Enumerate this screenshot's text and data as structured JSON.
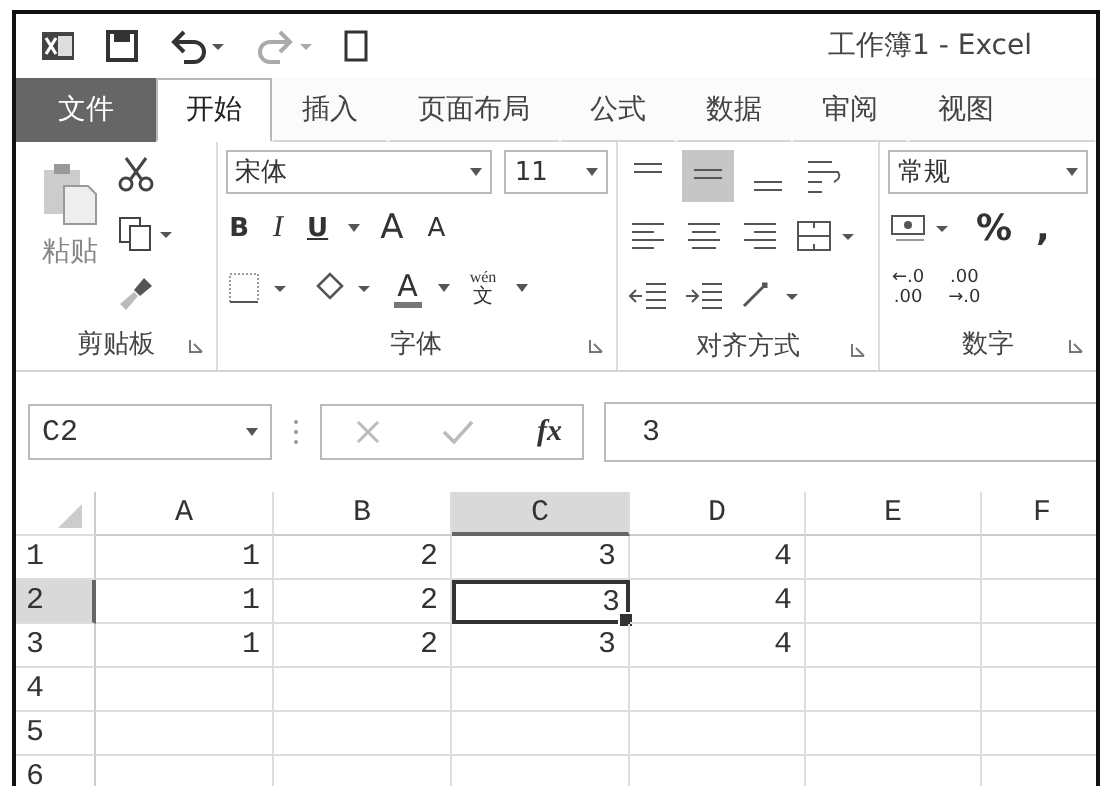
{
  "title_bar": {
    "title": "工作簿1 - Excel"
  },
  "tabs": [
    {
      "label": "文件",
      "kind": "file",
      "selected": false
    },
    {
      "label": "开始",
      "kind": "tab",
      "selected": true
    },
    {
      "label": "插入",
      "kind": "tab",
      "selected": false
    },
    {
      "label": "页面布局",
      "kind": "tab",
      "selected": false
    },
    {
      "label": "公式",
      "kind": "tab",
      "selected": false
    },
    {
      "label": "数据",
      "kind": "tab",
      "selected": false
    },
    {
      "label": "审阅",
      "kind": "tab",
      "selected": false
    },
    {
      "label": "视图",
      "kind": "tab",
      "selected": false
    }
  ],
  "ribbon": {
    "paste_label": "粘贴",
    "font_name": "宋体",
    "font_size": "11",
    "bold": "B",
    "italic": "I",
    "underline": "U",
    "grow_font": "A",
    "shrink_font": "A",
    "font_color": "A",
    "phonetic_top": "wén",
    "phonetic_bottom": "文",
    "number_format": "常规",
    "percent": "%",
    "comma": ",",
    "decimal_buttons": [
      {
        "top": "←.0",
        "bottom": ".00"
      },
      {
        "top": ".00",
        "bottom": "→.0"
      }
    ],
    "groups": [
      {
        "label": "剪贴板"
      },
      {
        "label": "字体"
      },
      {
        "label": "对齐方式"
      },
      {
        "label": "数字"
      }
    ]
  },
  "formula_bar": {
    "name_box": "C2",
    "fx": "fx",
    "formula": "3"
  },
  "sheet": {
    "columns": [
      {
        "label": "A",
        "selected": false
      },
      {
        "label": "B",
        "selected": false
      },
      {
        "label": "C",
        "selected": true
      },
      {
        "label": "D",
        "selected": false
      },
      {
        "label": "E",
        "selected": false
      },
      {
        "label": "F",
        "selected": false
      }
    ],
    "rows": [
      {
        "label": "1",
        "selected": false,
        "cells": [
          {
            "value": "1",
            "selected": false
          },
          {
            "value": "2",
            "selected": false
          },
          {
            "value": "3",
            "selected": false
          },
          {
            "value": "4",
            "selected": false
          }
        ]
      },
      {
        "label": "2",
        "selected": true,
        "cells": [
          {
            "value": "1",
            "selected": false
          },
          {
            "value": "2",
            "selected": false
          },
          {
            "value": "3",
            "selected": true
          },
          {
            "value": "4",
            "selected": false
          }
        ]
      },
      {
        "label": "3",
        "selected": false,
        "cells": [
          {
            "value": "1",
            "selected": false
          },
          {
            "value": "2",
            "selected": false
          },
          {
            "value": "3",
            "selected": false
          },
          {
            "value": "4",
            "selected": false
          }
        ]
      },
      {
        "label": "4",
        "selected": false
      },
      {
        "label": "5",
        "selected": false
      },
      {
        "label": "6",
        "selected": false
      }
    ]
  }
}
